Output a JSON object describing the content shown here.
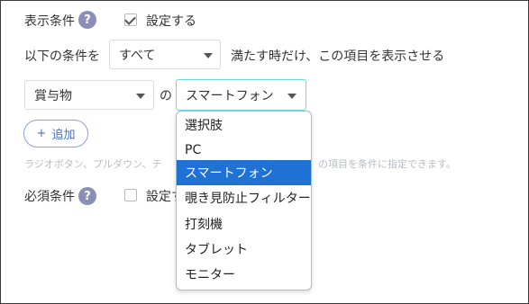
{
  "display_condition": {
    "label": "表示条件",
    "help": "?",
    "checkbox_label": "設定する",
    "checked": true
  },
  "condition_row": {
    "prefix": "以下の条件を",
    "mode_value": "すべて",
    "suffix": "満たす時だけ、この項目を表示させる"
  },
  "rule": {
    "field_value": "賞与物",
    "connector": "の",
    "value_selected": "スマートフォン"
  },
  "add_button": {
    "plus": "+",
    "label": "追加"
  },
  "hint": {
    "left": "ラジオボタン、プルダウン、チ",
    "right": "の項目を条件に指定できます。"
  },
  "required_condition": {
    "label": "必須条件",
    "help": "?",
    "checkbox_label": "設定す",
    "checked": false
  },
  "dropdown": {
    "options": [
      {
        "label": "選択肢"
      },
      {
        "label": "PC"
      },
      {
        "label": "スマートフォン"
      },
      {
        "label": "覗き見防止フィルター"
      },
      {
        "label": "打刻機"
      },
      {
        "label": "タブレット"
      },
      {
        "label": "モニター"
      }
    ],
    "selected_option": "スマートフォン"
  },
  "colors": {
    "help_icon_bg": "#8b8fb8",
    "selected_option_bg": "#1f71d4",
    "add_button_accent": "#4a72c4",
    "active_select_border": "#6fd6e3",
    "hint_text": "#b9bcc4"
  }
}
